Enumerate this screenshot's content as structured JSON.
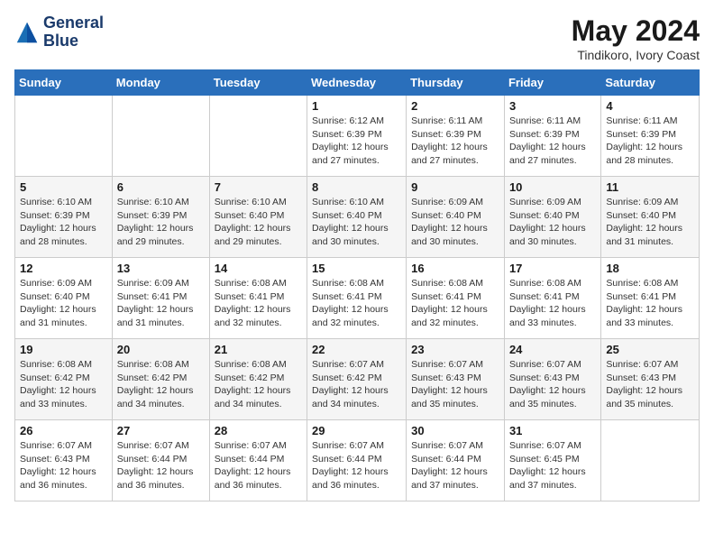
{
  "logo": {
    "line1": "General",
    "line2": "Blue"
  },
  "title": "May 2024",
  "location": "Tindikoro, Ivory Coast",
  "days_of_week": [
    "Sunday",
    "Monday",
    "Tuesday",
    "Wednesday",
    "Thursday",
    "Friday",
    "Saturday"
  ],
  "weeks": [
    [
      {
        "day": "",
        "info": ""
      },
      {
        "day": "",
        "info": ""
      },
      {
        "day": "",
        "info": ""
      },
      {
        "day": "1",
        "info": "Sunrise: 6:12 AM\nSunset: 6:39 PM\nDaylight: 12 hours\nand 27 minutes."
      },
      {
        "day": "2",
        "info": "Sunrise: 6:11 AM\nSunset: 6:39 PM\nDaylight: 12 hours\nand 27 minutes."
      },
      {
        "day": "3",
        "info": "Sunrise: 6:11 AM\nSunset: 6:39 PM\nDaylight: 12 hours\nand 27 minutes."
      },
      {
        "day": "4",
        "info": "Sunrise: 6:11 AM\nSunset: 6:39 PM\nDaylight: 12 hours\nand 28 minutes."
      }
    ],
    [
      {
        "day": "5",
        "info": "Sunrise: 6:10 AM\nSunset: 6:39 PM\nDaylight: 12 hours\nand 28 minutes."
      },
      {
        "day": "6",
        "info": "Sunrise: 6:10 AM\nSunset: 6:39 PM\nDaylight: 12 hours\nand 29 minutes."
      },
      {
        "day": "7",
        "info": "Sunrise: 6:10 AM\nSunset: 6:40 PM\nDaylight: 12 hours\nand 29 minutes."
      },
      {
        "day": "8",
        "info": "Sunrise: 6:10 AM\nSunset: 6:40 PM\nDaylight: 12 hours\nand 30 minutes."
      },
      {
        "day": "9",
        "info": "Sunrise: 6:09 AM\nSunset: 6:40 PM\nDaylight: 12 hours\nand 30 minutes."
      },
      {
        "day": "10",
        "info": "Sunrise: 6:09 AM\nSunset: 6:40 PM\nDaylight: 12 hours\nand 30 minutes."
      },
      {
        "day": "11",
        "info": "Sunrise: 6:09 AM\nSunset: 6:40 PM\nDaylight: 12 hours\nand 31 minutes."
      }
    ],
    [
      {
        "day": "12",
        "info": "Sunrise: 6:09 AM\nSunset: 6:40 PM\nDaylight: 12 hours\nand 31 minutes."
      },
      {
        "day": "13",
        "info": "Sunrise: 6:09 AM\nSunset: 6:41 PM\nDaylight: 12 hours\nand 31 minutes."
      },
      {
        "day": "14",
        "info": "Sunrise: 6:08 AM\nSunset: 6:41 PM\nDaylight: 12 hours\nand 32 minutes."
      },
      {
        "day": "15",
        "info": "Sunrise: 6:08 AM\nSunset: 6:41 PM\nDaylight: 12 hours\nand 32 minutes."
      },
      {
        "day": "16",
        "info": "Sunrise: 6:08 AM\nSunset: 6:41 PM\nDaylight: 12 hours\nand 32 minutes."
      },
      {
        "day": "17",
        "info": "Sunrise: 6:08 AM\nSunset: 6:41 PM\nDaylight: 12 hours\nand 33 minutes."
      },
      {
        "day": "18",
        "info": "Sunrise: 6:08 AM\nSunset: 6:41 PM\nDaylight: 12 hours\nand 33 minutes."
      }
    ],
    [
      {
        "day": "19",
        "info": "Sunrise: 6:08 AM\nSunset: 6:42 PM\nDaylight: 12 hours\nand 33 minutes."
      },
      {
        "day": "20",
        "info": "Sunrise: 6:08 AM\nSunset: 6:42 PM\nDaylight: 12 hours\nand 34 minutes."
      },
      {
        "day": "21",
        "info": "Sunrise: 6:08 AM\nSunset: 6:42 PM\nDaylight: 12 hours\nand 34 minutes."
      },
      {
        "day": "22",
        "info": "Sunrise: 6:07 AM\nSunset: 6:42 PM\nDaylight: 12 hours\nand 34 minutes."
      },
      {
        "day": "23",
        "info": "Sunrise: 6:07 AM\nSunset: 6:43 PM\nDaylight: 12 hours\nand 35 minutes."
      },
      {
        "day": "24",
        "info": "Sunrise: 6:07 AM\nSunset: 6:43 PM\nDaylight: 12 hours\nand 35 minutes."
      },
      {
        "day": "25",
        "info": "Sunrise: 6:07 AM\nSunset: 6:43 PM\nDaylight: 12 hours\nand 35 minutes."
      }
    ],
    [
      {
        "day": "26",
        "info": "Sunrise: 6:07 AM\nSunset: 6:43 PM\nDaylight: 12 hours\nand 36 minutes."
      },
      {
        "day": "27",
        "info": "Sunrise: 6:07 AM\nSunset: 6:44 PM\nDaylight: 12 hours\nand 36 minutes."
      },
      {
        "day": "28",
        "info": "Sunrise: 6:07 AM\nSunset: 6:44 PM\nDaylight: 12 hours\nand 36 minutes."
      },
      {
        "day": "29",
        "info": "Sunrise: 6:07 AM\nSunset: 6:44 PM\nDaylight: 12 hours\nand 36 minutes."
      },
      {
        "day": "30",
        "info": "Sunrise: 6:07 AM\nSunset: 6:44 PM\nDaylight: 12 hours\nand 37 minutes."
      },
      {
        "day": "31",
        "info": "Sunrise: 6:07 AM\nSunset: 6:45 PM\nDaylight: 12 hours\nand 37 minutes."
      },
      {
        "day": "",
        "info": ""
      }
    ]
  ]
}
